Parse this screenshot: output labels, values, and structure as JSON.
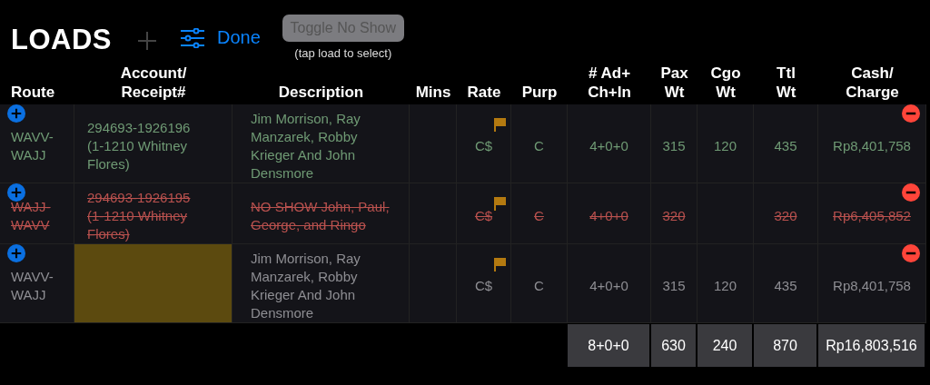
{
  "title": "LOADS",
  "toolbar": {
    "add_enabled": false,
    "done_label": "Done",
    "toggle_button": {
      "label": "Toggle No Show",
      "disabled": true
    },
    "hint": "(tap load to select)"
  },
  "table": {
    "columns": [
      "Route",
      "Account/\nReceipt#",
      "Description",
      "Mins",
      "Rate",
      "Purp",
      "# Ad+\nCh+In",
      "Pax\nWt",
      "Cgo\nWt",
      "Ttl\nWt",
      "Cash/\nCharge"
    ],
    "rows": [
      {
        "kind": "confirmed",
        "account_highlighted": false,
        "flagged": true,
        "route": "WAVV-WAJJ",
        "account": "294693-1926196 (1-1210 Whitney Flores)",
        "description": "Jim Morrison, Ray Manzarek, Robby Krieger And John Densmore",
        "rate": "C$",
        "purp": "C",
        "count": "4+0+0",
        "pax_wt": "315",
        "cgo_wt": "120",
        "ttl_wt": "435",
        "cash": "Rp8,401,758"
      },
      {
        "kind": "no_show",
        "account_highlighted": false,
        "flagged": true,
        "route": "WAJJ-WAVV",
        "account": "294693-1926195 (1-1210 Whitney Flores)",
        "description": "NO SHOW John, Paul, George, and Ringo",
        "rate": "C$",
        "purp": "C",
        "count": "4+0+0",
        "pax_wt": "320",
        "ttl_wt": "320",
        "cash": "Rp6,405,852"
      },
      {
        "kind": "unconfirmed",
        "account_highlighted": true,
        "flagged": true,
        "route": "WAVV-WAJJ",
        "description": "Jim Morrison, Ray Manzarek, Robby Krieger And John Densmore",
        "rate": "C$",
        "purp": "C",
        "count": "4+0+0",
        "pax_wt": "315",
        "cgo_wt": "120",
        "ttl_wt": "435",
        "cash": "Rp8,401,758"
      }
    ],
    "totals": {
      "count": "8+0+0",
      "pax_wt": "630",
      "cgo_wt": "240",
      "ttl_wt": "870",
      "cash": "Rp16,803,516"
    }
  }
}
